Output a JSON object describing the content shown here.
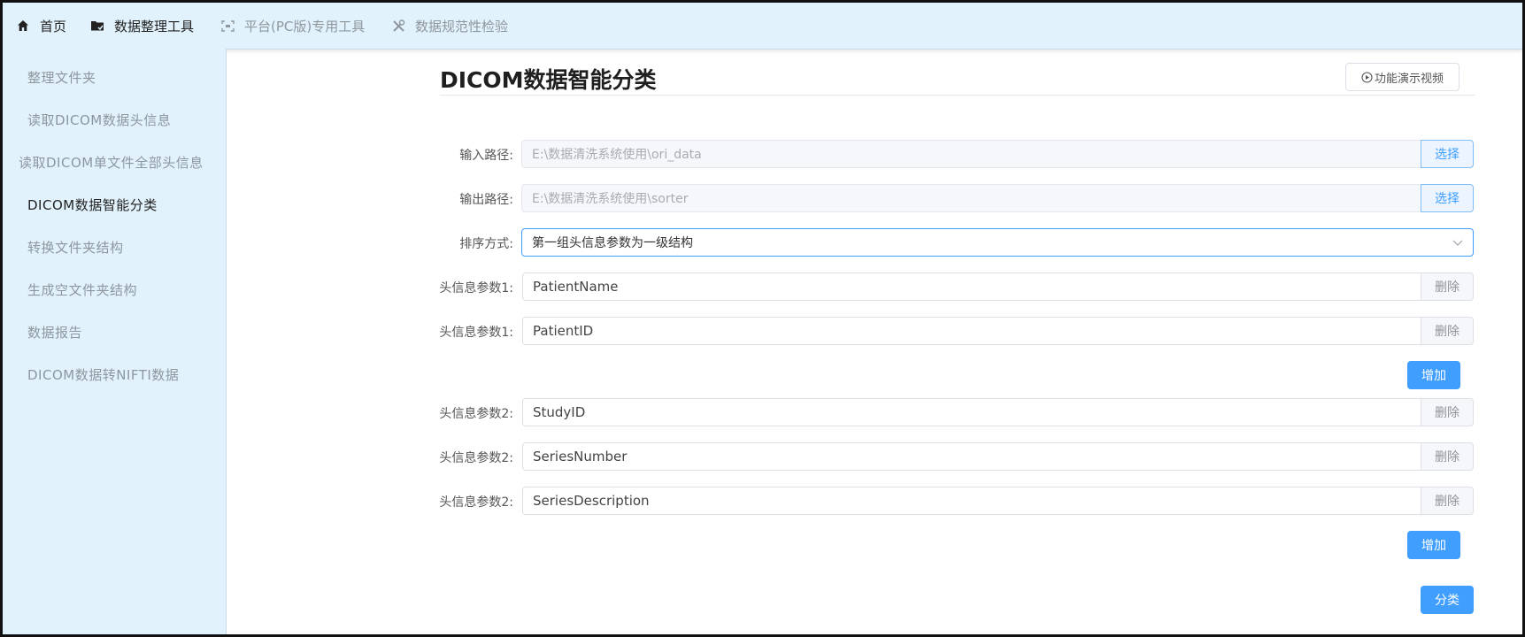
{
  "nav": {
    "items": [
      {
        "label": "首页",
        "icon": "home-icon"
      },
      {
        "label": "数据整理工具",
        "icon": "folder-icon"
      },
      {
        "label": "平台(PC版)专用工具",
        "icon": "scan-icon"
      },
      {
        "label": "数据规范性检验",
        "icon": "tools-icon"
      }
    ]
  },
  "sidebar": {
    "items": [
      {
        "label": "整理文件夹"
      },
      {
        "label": "读取DICOM数据头信息"
      },
      {
        "label": "读取DICOM单文件全部头信息"
      },
      {
        "label": "DICOM数据智能分类",
        "active": true
      },
      {
        "label": "转换文件夹结构"
      },
      {
        "label": "生成空文件夹结构"
      },
      {
        "label": "数据报告"
      },
      {
        "label": "DICOM数据转NIFTI数据"
      }
    ]
  },
  "main": {
    "title": "DICOM数据智能分类",
    "demo_button": "功能演示视频",
    "input_path": {
      "label": "输入路径:",
      "value": "E:\\数据清洗系统使用\\ori_data",
      "button": "选择"
    },
    "output_path": {
      "label": "输出路径:",
      "value": "E:\\数据清洗系统使用\\sorter",
      "button": "选择"
    },
    "sort_mode": {
      "label": "排序方式:",
      "value": "第一组头信息参数为一级结构"
    },
    "group1": {
      "params": [
        {
          "label": "头信息参数1:",
          "value": "PatientName",
          "button": "删除"
        },
        {
          "label": "头信息参数1:",
          "value": "PatientID",
          "button": "删除"
        }
      ],
      "add_button": "增加"
    },
    "group2": {
      "params": [
        {
          "label": "头信息参数2:",
          "value": "StudyID",
          "button": "删除"
        },
        {
          "label": "头信息参数2:",
          "value": "SeriesNumber",
          "button": "删除"
        },
        {
          "label": "头信息参数2:",
          "value": "SeriesDescription",
          "button": "删除"
        }
      ],
      "add_button": "增加"
    },
    "classify_button": "分类"
  },
  "colors": {
    "accent": "#409eff",
    "sidebar_bg": "#e1f2fc",
    "nav_bg": "#e1f2fc"
  }
}
